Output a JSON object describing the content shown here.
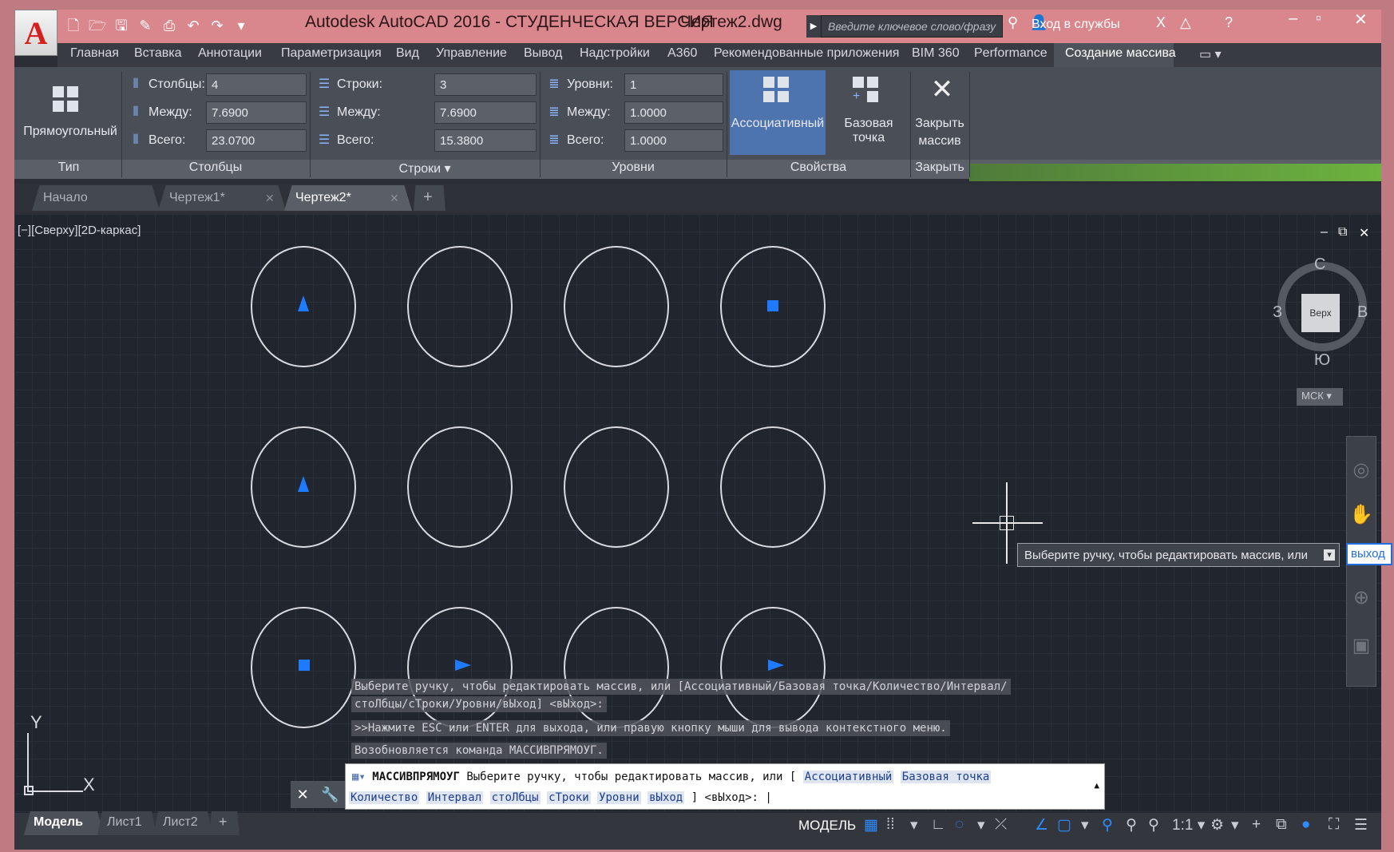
{
  "window": {
    "app_title": "Autodesk AutoCAD 2016 - СТУДЕНЧЕСКАЯ ВЕРСИЯ",
    "doc_title": "Чертеж2.dwg",
    "search_placeholder": "Введите ключевое слово/фразу",
    "signin_label": "Вход в службы"
  },
  "menu_tabs": [
    "Главная",
    "Вставка",
    "Аннотации",
    "Параметризация",
    "Вид",
    "Управление",
    "Вывод",
    "Надстройки",
    "A360",
    "Рекомендованные приложения",
    "BIM 360",
    "Performance",
    "Создание массива"
  ],
  "ribbon": {
    "type_panel": {
      "button_label": "Прямоугольный",
      "title": "Тип"
    },
    "columns_panel": {
      "title": "Столбцы",
      "count_label": "Столбцы:",
      "count_value": "4",
      "between_label": "Между:",
      "between_value": "7.6900",
      "total_label": "Всего:",
      "total_value": "23.0700"
    },
    "rows_panel": {
      "title": "Строки ▾",
      "count_label": "Строки:",
      "count_value": "3",
      "between_label": "Между:",
      "between_value": "7.6900",
      "total_label": "Всего:",
      "total_value": "15.3800"
    },
    "levels_panel": {
      "title": "Уровни",
      "count_label": "Уровни:",
      "count_value": "1",
      "between_label": "Между:",
      "between_value": "1.0000",
      "total_label": "Всего:",
      "total_value": "1.0000"
    },
    "properties_panel": {
      "title": "Свойства",
      "associative_label": "Ассоциативный",
      "basepoint_label": "Базовая точка"
    },
    "close_panel": {
      "title": "Закрыть",
      "close_label_1": "Закрыть",
      "close_label_2": "массив"
    }
  },
  "doc_tabs": [
    {
      "label": "Начало"
    },
    {
      "label": "Чертеж1*"
    },
    {
      "label": "Чертеж2*"
    }
  ],
  "viewport": {
    "label": "[−][Сверху][2D-каркас]",
    "compass_n": "С",
    "compass_s": "Ю",
    "compass_w": "З",
    "compass_e": "В",
    "viewcube_face": "Верх",
    "wcs_label": "МСК ▾",
    "ucs_x": "X",
    "ucs_y": "Y"
  },
  "tooltip": {
    "prompt": "Выберите ручку, чтобы редактировать массив, или",
    "option": "выход"
  },
  "command_history": [
    "Выберите ручку, чтобы редактировать массив, или [Ассоциативный/Базовая точка/Количество/Интервал/",
    "стоЛбцы/сТроки/Уровни/вЫход] <вЫход>:",
    ">>Нажмите ESC или ENTER для выхода, или правую кнопку мыши для вывода контекстного меню.",
    "Возобновляется команда МАССИВПРЯМОУГ."
  ],
  "command_line": {
    "command": "МАССИВПРЯМОУГ",
    "prompt": "Выберите ручку, чтобы редактировать массив, или [",
    "opt_assoc": "Ассоциативный",
    "opt_base": "Базовая точка",
    "opt_count": "Количество",
    "opt_interval": "Интервал",
    "opt_columns": "стоЛбцы",
    "opt_rows": "сТроки",
    "opt_levels": "Уровни",
    "opt_exit": "вЫход",
    "suffix": "] <вЫход>:"
  },
  "layout_tabs": [
    "Модель",
    "Лист1",
    "Лист2"
  ],
  "statusbar": {
    "model_label": "МОДЕЛЬ",
    "scale_label": "1:1 ▾"
  },
  "colors": {
    "grip_blue": "#1e7bff",
    "title_bar": "#d9868c",
    "active_tab": "#4e74b0"
  }
}
